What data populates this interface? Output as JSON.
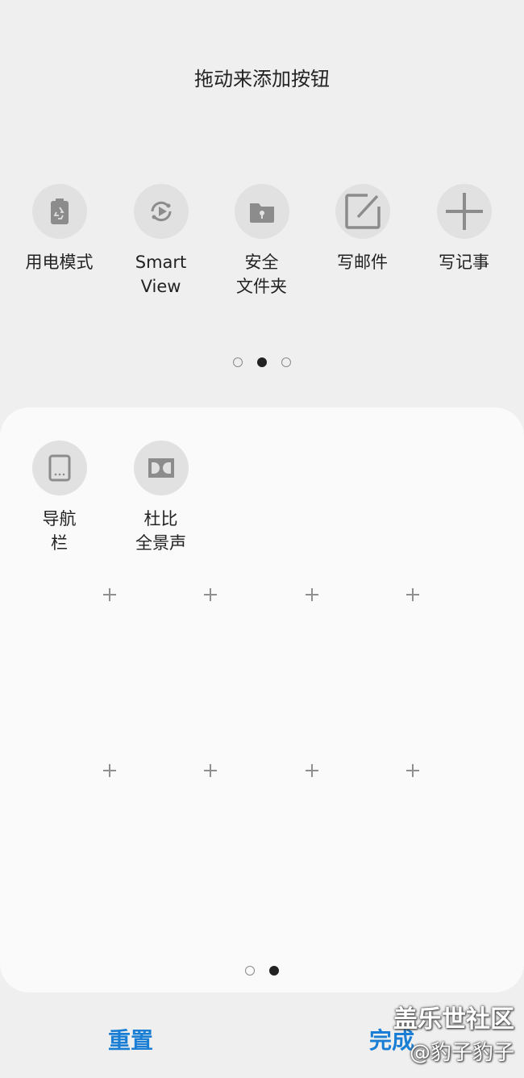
{
  "title": "拖动来添加按钮",
  "available_tiles": [
    {
      "label_lines": [
        "用电模式"
      ],
      "icon": "battery-recycle-icon"
    },
    {
      "label_lines": [
        "Smart",
        "View"
      ],
      "icon": "smart-view-icon"
    },
    {
      "label_lines": [
        "安全",
        "文件夹"
      ],
      "icon": "secure-folder-icon"
    },
    {
      "label_lines": [
        "写邮件"
      ],
      "icon": "compose-icon"
    },
    {
      "label_lines": [
        "写记事"
      ],
      "icon": "plus-icon"
    }
  ],
  "top_pager": {
    "count": 3,
    "active": 1
  },
  "panel_tiles": [
    {
      "label_lines": [
        "导航",
        "栏"
      ],
      "icon": "navigation-bar-icon"
    },
    {
      "label_lines": [
        "杜比",
        "全景声"
      ],
      "icon": "dolby-icon"
    }
  ],
  "bottom_pager": {
    "count": 2,
    "active": 1
  },
  "buttons": {
    "reset": "重置",
    "done": "完成"
  },
  "watermark": {
    "line1": "盖乐世社区",
    "line2": "@豹子豹子"
  },
  "colors": {
    "accent": "#1a7fd4",
    "tile_bg": "#e1e1e1",
    "icon": "#8c8c8c",
    "panel_bg": "#fafafa",
    "screen_bg": "#efefef"
  }
}
